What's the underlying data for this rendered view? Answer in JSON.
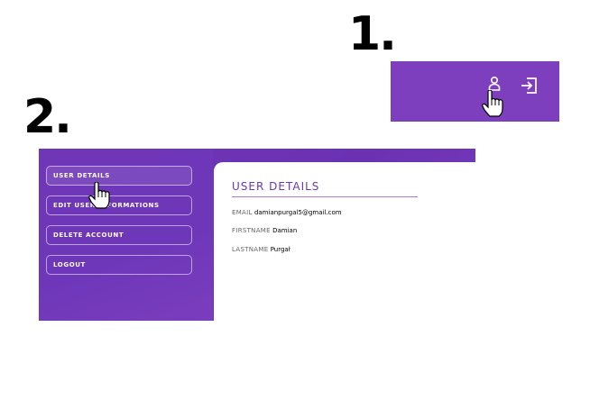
{
  "steps": {
    "one": "1.",
    "two": "2."
  },
  "topbar": {
    "bg_color": "#7e3fbf",
    "icons": [
      "user-icon",
      "logout-icon",
      "hand-pointer-icon"
    ]
  },
  "sidebar": {
    "items": [
      {
        "label": "USER DETAILS",
        "active": true
      },
      {
        "label": "EDIT USER INFORMATIONS"
      },
      {
        "label": "DELETE ACCOUNT"
      },
      {
        "label": "LOGOUT"
      }
    ]
  },
  "card": {
    "title": "USER DETAILS",
    "fields": [
      {
        "key": "EMAIL",
        "value": "damianpurgal5@gmail.com"
      },
      {
        "key": "FIRSTNAME",
        "value": "Damian"
      },
      {
        "key": "LASTNAME",
        "value": "Purgał"
      }
    ]
  },
  "colors": {
    "accent": "#6b36b5",
    "panel": "#7035b8"
  }
}
